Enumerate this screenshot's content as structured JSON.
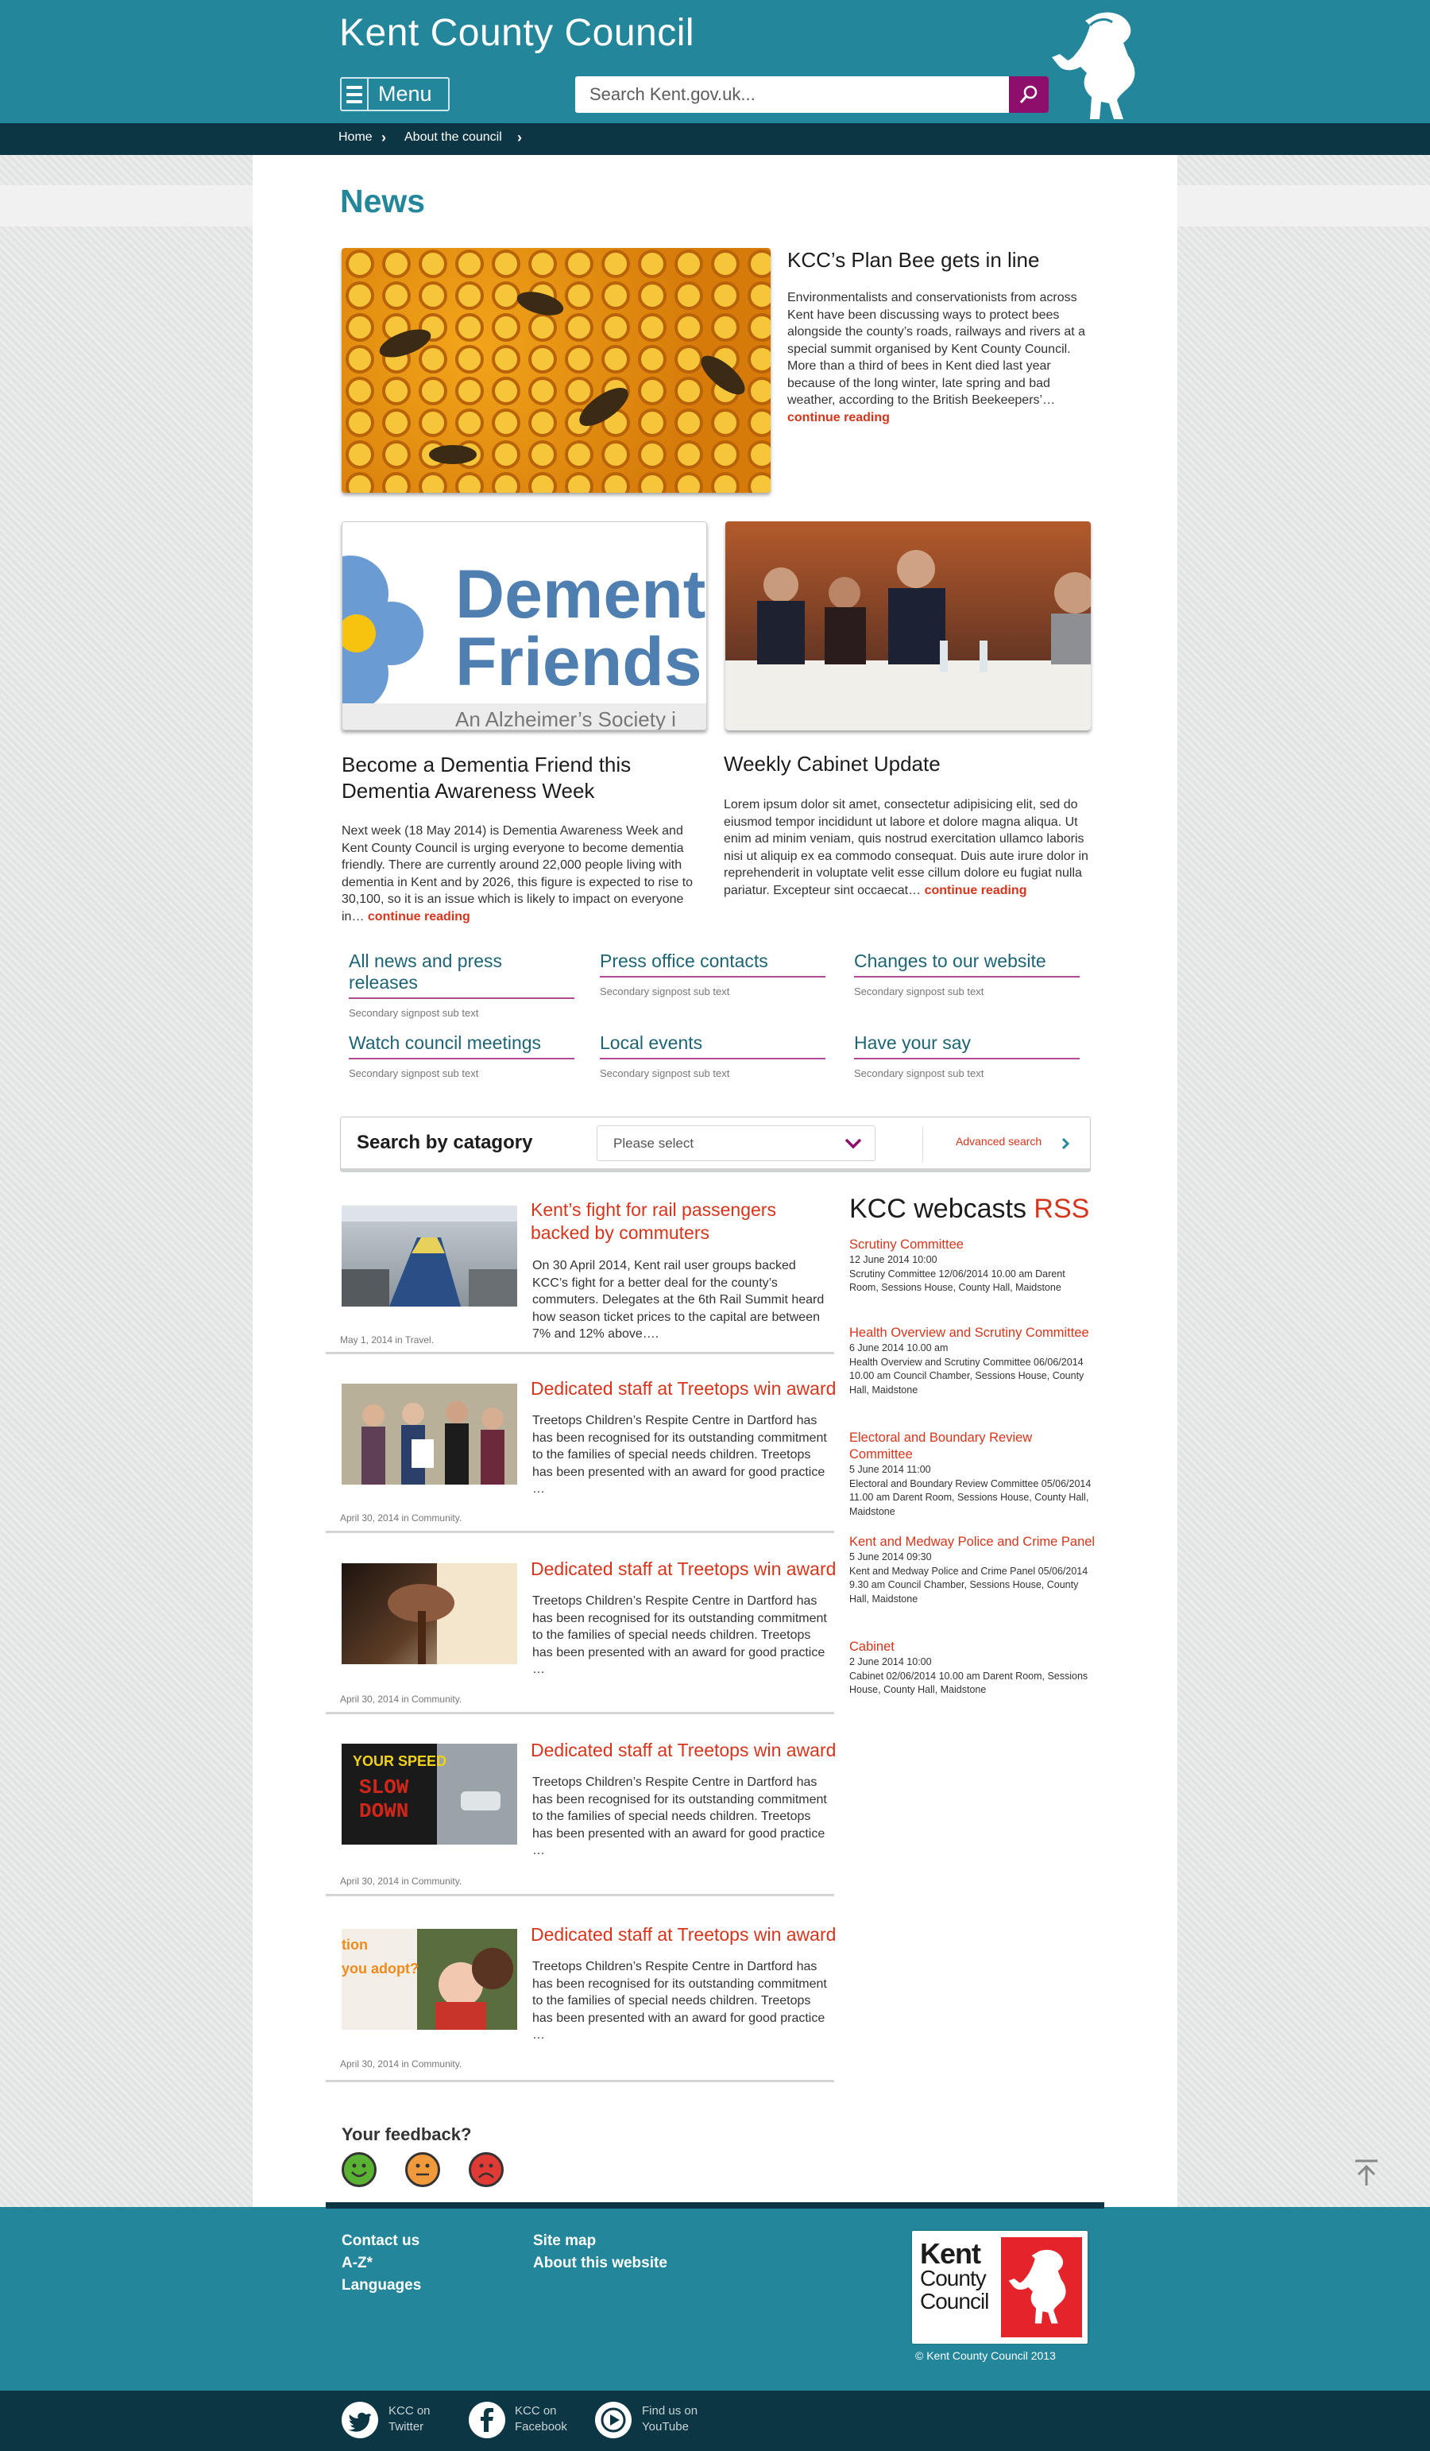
{
  "header": {
    "brand": "Kent County Council",
    "menu_label": "Menu",
    "search_placeholder": "Search Kent.gov.uk..."
  },
  "breadcrumb": [
    "Home",
    "About the council"
  ],
  "page_title": "News",
  "feature": {
    "title": "KCC’s Plan Bee gets in line",
    "body": "Environmentalists and conservationists from across Kent have been discussing ways to protect bees alongside the county’s roads, railways and rivers at a special summit organised by Kent County Council. More than a third of bees in Kent died last year because of the long winter, late spring and bad weather, according to the British Beekeepers’…",
    "more": "continue reading"
  },
  "story_left": {
    "title": "Become a Dementia Friend this Dementia Awareness Week",
    "image_text_1": "Dementia",
    "image_text_2": "Friends",
    "image_text_3": "An Alzheimer’s Society i",
    "body": "Next week (18 May 2014) is Dementia Awareness Week and Kent County Council is urging everyone to become dementia friendly. There are currently around 22,000 people living with dementia in Kent and by 2026, this figure is expected to rise to 30,100, so it is an issue which is likely to impact on everyone in…",
    "more": "continue reading"
  },
  "story_right": {
    "title": "Weekly Cabinet Update",
    "body": "Lorem ipsum dolor sit amet, consectetur adipisicing elit, sed do eiusmod tempor incididunt ut labore et dolore magna aliqua. Ut enim ad minim veniam, quis nostrud exercitation ullamco laboris nisi ut aliquip ex ea commodo consequat. Duis aute irure dolor in reprehenderit in voluptate velit esse cillum dolore eu fugiat nulla pariatur. Excepteur sint occaecat…",
    "more": "continue reading"
  },
  "signposts": [
    {
      "title": "All news and press releases",
      "sub": "Secondary signpost sub text"
    },
    {
      "title": "Press office contacts",
      "sub": "Secondary signpost sub text"
    },
    {
      "title": "Changes to our website",
      "sub": "Secondary signpost sub text"
    },
    {
      "title": "Watch council meetings",
      "sub": "Secondary signpost sub text"
    },
    {
      "title": "Local events",
      "sub": "Secondary signpost sub text"
    },
    {
      "title": "Have your say",
      "sub": "Secondary signpost sub text"
    }
  ],
  "category_search": {
    "label": "Search by catagory",
    "select_value": "Please select",
    "advanced": "Advanced search"
  },
  "news": [
    {
      "title": "Kent’s fight for rail passengers backed by commuters",
      "body": "On 30 April 2014, Kent rail user groups backed KCC’s fight for a better deal for the county’s commuters. Delegates at the 6th Rail Summit heard how season ticket prices to the capital are between 7% and 12% above….",
      "meta": "May 1, 2014 in Travel."
    },
    {
      "title": "Dedicated staff at Treetops win award",
      "body": "Treetops Children’s Respite Centre in Dartford has has been recognised for its outstanding commitment to the families of special needs children. Treetops has been presented with an award for good practice …",
      "meta": "April 30, 2014 in Community."
    },
    {
      "title": "Dedicated staff at Treetops win award",
      "body": "Treetops Children’s Respite Centre in Dartford has has been recognised for its outstanding commitment to the families of special needs children. Treetops has been presented with an award for good practice …",
      "meta": "April 30, 2014 in Community."
    },
    {
      "title": "Dedicated staff at Treetops win award",
      "body": "Treetops Children’s Respite Centre in Dartford has has been recognised for its outstanding commitment to the families of special needs children. Treetops has been presented with an award for good practice …",
      "meta": "April 30, 2014 in Community."
    },
    {
      "title": "Dedicated staff at Treetops win award",
      "body": "Treetops Children’s Respite Centre in Dartford has has been recognised for its outstanding commitment to the families of special needs children. Treetops has been presented with an award for good practice …",
      "meta": "April 30, 2014 in Community."
    }
  ],
  "thumb_texts": {
    "speed_1": "YOUR SPEED",
    "speed_2": "SLOW",
    "speed_3": "DOWN",
    "adopt_1": "tion",
    "adopt_2": "you adopt?"
  },
  "webcasts": {
    "title": "KCC webcasts",
    "rss": "RSS",
    "items": [
      {
        "name": "Scrutiny Committee",
        "date": "12 June 2014 10:00",
        "desc": "Scrutiny Committee 12/06/2014 10.00 am Darent Room, Sessions House, County Hall, Maidstone"
      },
      {
        "name": "Health Overview and Scrutiny Committee",
        "date": "6 June 2014 10.00 am",
        "desc": "Health Overview and Scrutiny Committee 06/06/2014 10.00 am Council Chamber, Sessions House, County Hall, Maidstone"
      },
      {
        "name": "Electoral and Boundary Review Committee",
        "date": "5 June 2014 11:00",
        "desc": "Electoral and Boundary Review Committee 05/06/2014 11.00 am Darent Room, Sessions House, County Hall, Maidstone"
      },
      {
        "name": "Kent and Medway Police and Crime Panel",
        "date": "5 June 2014 09:30",
        "desc": "Kent and Medway Police and Crime Panel 05/06/2014 9.30 am Council Chamber, Sessions House, County Hall, Maidstone"
      },
      {
        "name": "Cabinet",
        "date": "2 June 2014 10:00",
        "desc": "Cabinet 02/06/2014 10.00 am Darent Room, Sessions House, County Hall, Maidstone"
      }
    ]
  },
  "feedback": {
    "title": "Your feedback?"
  },
  "footer": {
    "links_col1": [
      "Contact us",
      "A-Z*",
      "Languages"
    ],
    "links_col2": [
      "Site map",
      "About this website"
    ],
    "logo_lines": [
      "Kent",
      "County",
      "Council"
    ],
    "copyright": "© Kent County Council 2013"
  },
  "social": [
    {
      "line1": "KCC on",
      "line2": "Twitter",
      "icon": "twitter-icon"
    },
    {
      "line1": "KCC on",
      "line2": "Facebook",
      "icon": "facebook-icon"
    },
    {
      "line1": "Find us on",
      "line2": "YouTube",
      "icon": "youtube-icon"
    }
  ],
  "colors": {
    "teal": "#23869a",
    "navy": "#0d3644",
    "accent_red": "#d7351b",
    "magenta": "#8e0f6b"
  }
}
